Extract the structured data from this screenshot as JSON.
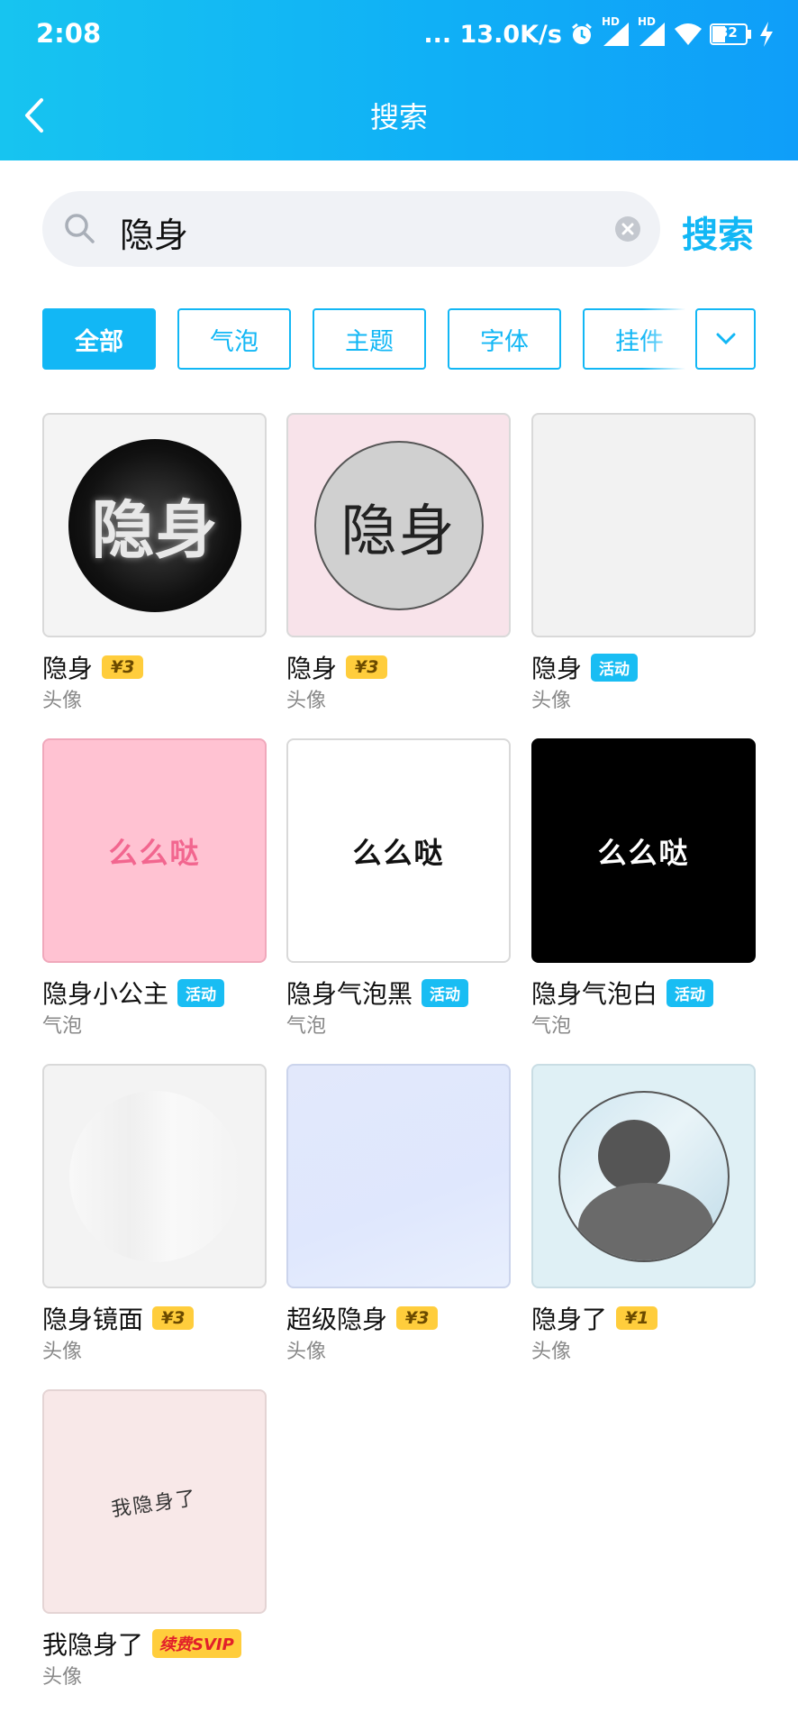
{
  "status": {
    "time": "2:08",
    "speed": "... 13.0K/s",
    "hd1": "HD",
    "hd2": "HD",
    "battery": "32"
  },
  "header": {
    "title": "搜索"
  },
  "search": {
    "value": "隐身",
    "button": "搜索"
  },
  "filters": [
    "全部",
    "气泡",
    "主题",
    "字体",
    "挂件"
  ],
  "items": [
    {
      "name": "隐身",
      "badge": "¥3",
      "badge_type": "price",
      "category": "头像",
      "thumb_text": "隐身"
    },
    {
      "name": "隐身",
      "badge": "¥3",
      "badge_type": "price",
      "category": "头像",
      "thumb_text": "隐身"
    },
    {
      "name": "隐身",
      "badge": "活动",
      "badge_type": "event",
      "category": "头像"
    },
    {
      "name": "隐身小公主",
      "badge": "活动",
      "badge_type": "event",
      "category": "气泡",
      "thumb_text": "么么哒"
    },
    {
      "name": "隐身气泡黑",
      "badge": "活动",
      "badge_type": "event",
      "category": "气泡",
      "thumb_text": "么么哒"
    },
    {
      "name": "隐身气泡白",
      "badge": "活动",
      "badge_type": "event",
      "category": "气泡",
      "thumb_text": "么么哒"
    },
    {
      "name": "隐身镜面",
      "badge": "¥3",
      "badge_type": "price",
      "category": "头像"
    },
    {
      "name": "超级隐身",
      "badge": "¥3",
      "badge_type": "price",
      "category": "头像"
    },
    {
      "name": "隐身了",
      "badge": "¥1",
      "badge_type": "price",
      "category": "头像"
    },
    {
      "name": "我隐身了",
      "badge": "续费SVIP",
      "badge_type": "svip",
      "category": "头像",
      "thumb_text": "我隐身了"
    }
  ],
  "colors": {
    "accent": "#12b7f5",
    "price_badge": "#ffcd3c",
    "pink_text": "#f2668f"
  },
  "icons": [
    "back-arrow-icon",
    "search-icon",
    "clear-icon",
    "chevron-down-icon",
    "alarm-icon",
    "signal-icon",
    "wifi-icon",
    "battery-icon",
    "charging-icon"
  ]
}
